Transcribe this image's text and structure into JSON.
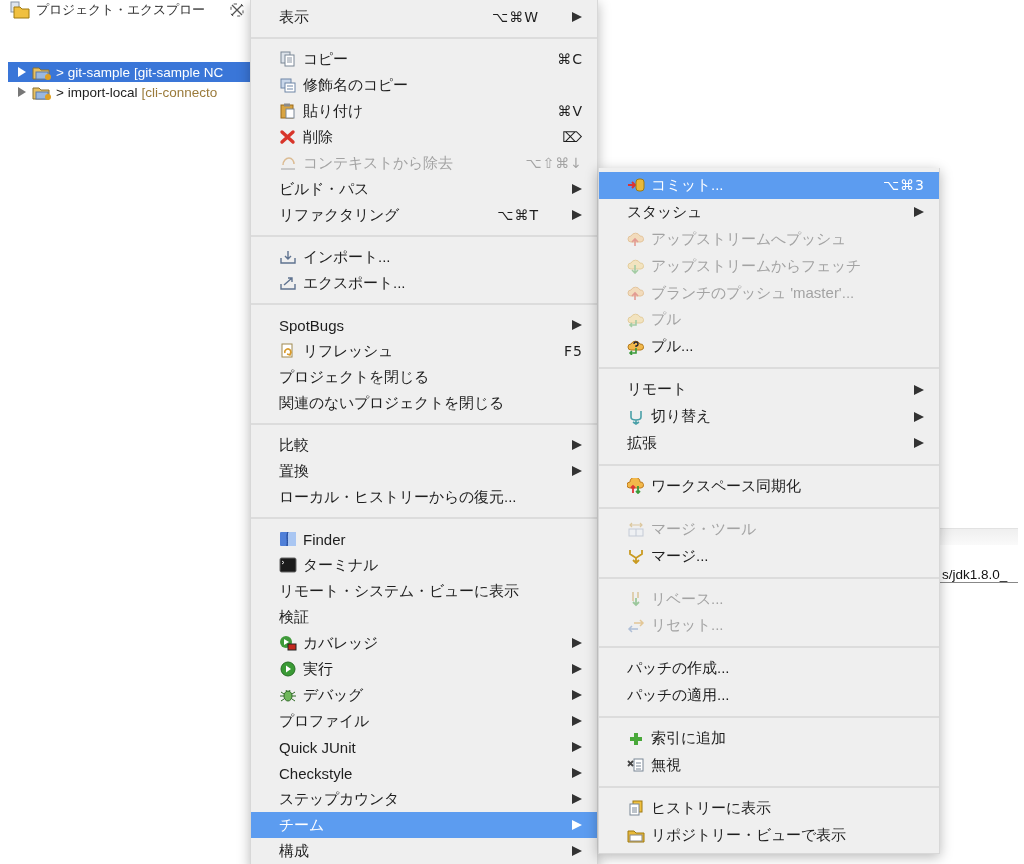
{
  "explorer": {
    "title": "プロジェクト・エクスプロー",
    "tree": [
      {
        "name": "> git-sample",
        "repo": "[git-sample NC",
        "selected": true,
        "expanded": false
      },
      {
        "name": "> import-local",
        "repo": "[cli-connecto",
        "selected": false,
        "expanded": false
      }
    ]
  },
  "context_menu": {
    "items": [
      {
        "kind": "item",
        "label": "表示",
        "shortcut": "⌥⌘W",
        "submenu": true,
        "disabled": false,
        "selected": false
      },
      {
        "kind": "separator"
      },
      {
        "kind": "item",
        "label": "コピー",
        "shortcut": "⌘C",
        "submenu": false,
        "disabled": false,
        "selected": false
      },
      {
        "kind": "item",
        "label": "修飾名のコピー",
        "submenu": false,
        "disabled": false,
        "selected": false
      },
      {
        "kind": "item",
        "label": "貼り付け",
        "shortcut": "⌘V",
        "submenu": false,
        "disabled": false,
        "selected": false
      },
      {
        "kind": "item",
        "label": "削除",
        "shortcut": "⌦",
        "submenu": false,
        "disabled": false,
        "selected": false
      },
      {
        "kind": "item",
        "label": "コンテキストから除去",
        "shortcut": "⌥⇧⌘↓",
        "submenu": false,
        "disabled": true,
        "selected": false
      },
      {
        "kind": "item",
        "label": "ビルド・パス",
        "submenu": true,
        "disabled": false,
        "selected": false
      },
      {
        "kind": "item",
        "label": "リファクタリング",
        "shortcut": "⌥⌘T",
        "submenu": true,
        "disabled": false,
        "selected": false
      },
      {
        "kind": "separator"
      },
      {
        "kind": "item",
        "label": "インポート...",
        "submenu": false,
        "disabled": false,
        "selected": false
      },
      {
        "kind": "item",
        "label": "エクスポート...",
        "submenu": false,
        "disabled": false,
        "selected": false
      },
      {
        "kind": "separator"
      },
      {
        "kind": "item",
        "label": "SpotBugs",
        "submenu": true,
        "disabled": false,
        "selected": false
      },
      {
        "kind": "item",
        "label": "リフレッシュ",
        "shortcut": "F5",
        "submenu": false,
        "disabled": false,
        "selected": false
      },
      {
        "kind": "item",
        "label": "プロジェクトを閉じる",
        "submenu": false,
        "disabled": false,
        "selected": false
      },
      {
        "kind": "item",
        "label": "関連のないプロジェクトを閉じる",
        "submenu": false,
        "disabled": false,
        "selected": false
      },
      {
        "kind": "separator"
      },
      {
        "kind": "item",
        "label": "比較",
        "submenu": true,
        "disabled": false,
        "selected": false
      },
      {
        "kind": "item",
        "label": "置換",
        "submenu": true,
        "disabled": false,
        "selected": false
      },
      {
        "kind": "item",
        "label": "ローカル・ヒストリーからの復元...",
        "submenu": false,
        "disabled": false,
        "selected": false
      },
      {
        "kind": "separator"
      },
      {
        "kind": "item",
        "label": "Finder",
        "submenu": false,
        "disabled": false,
        "selected": false
      },
      {
        "kind": "item",
        "label": "ターミナル",
        "submenu": false,
        "disabled": false,
        "selected": false
      },
      {
        "kind": "item",
        "label": "リモート・システム・ビューに表示",
        "submenu": false,
        "disabled": false,
        "selected": false
      },
      {
        "kind": "item",
        "label": "検証",
        "submenu": false,
        "disabled": false,
        "selected": false
      },
      {
        "kind": "item",
        "label": "カバレッジ",
        "submenu": true,
        "disabled": false,
        "selected": false
      },
      {
        "kind": "item",
        "label": "実行",
        "submenu": true,
        "disabled": false,
        "selected": false
      },
      {
        "kind": "item",
        "label": "デバッグ",
        "submenu": true,
        "disabled": false,
        "selected": false
      },
      {
        "kind": "item",
        "label": "プロファイル",
        "submenu": true,
        "disabled": false,
        "selected": false
      },
      {
        "kind": "item",
        "label": "Quick JUnit",
        "submenu": true,
        "disabled": false,
        "selected": false
      },
      {
        "kind": "item",
        "label": "Checkstyle",
        "submenu": true,
        "disabled": false,
        "selected": false
      },
      {
        "kind": "item",
        "label": "ステップカウンタ",
        "submenu": true,
        "disabled": false,
        "selected": false
      },
      {
        "kind": "item",
        "label": "チーム",
        "submenu": true,
        "disabled": false,
        "selected": true
      },
      {
        "kind": "item",
        "label": "構成",
        "submenu": true,
        "disabled": false,
        "selected": false
      }
    ]
  },
  "team_submenu": {
    "items": [
      {
        "kind": "item",
        "label": "コミット...",
        "shortcut": "⌥⌘3",
        "submenu": false,
        "disabled": false,
        "selected": true
      },
      {
        "kind": "item",
        "label": "スタッシュ",
        "submenu": true,
        "disabled": false,
        "selected": false
      },
      {
        "kind": "item",
        "label": "アップストリームへプッシュ",
        "submenu": false,
        "disabled": true,
        "selected": false
      },
      {
        "kind": "item",
        "label": "アップストリームからフェッチ",
        "submenu": false,
        "disabled": true,
        "selected": false
      },
      {
        "kind": "item",
        "label": "ブランチのプッシュ 'master'...",
        "submenu": false,
        "disabled": true,
        "selected": false
      },
      {
        "kind": "item",
        "label": "プル",
        "submenu": false,
        "disabled": true,
        "selected": false
      },
      {
        "kind": "item",
        "label": "プル...",
        "submenu": false,
        "disabled": false,
        "selected": false
      },
      {
        "kind": "separator"
      },
      {
        "kind": "item",
        "label": "リモート",
        "submenu": true,
        "disabled": false,
        "selected": false
      },
      {
        "kind": "item",
        "label": "切り替え",
        "submenu": true,
        "disabled": false,
        "selected": false
      },
      {
        "kind": "item",
        "label": "拡張",
        "submenu": true,
        "disabled": false,
        "selected": false
      },
      {
        "kind": "separator"
      },
      {
        "kind": "item",
        "label": "ワークスペース同期化",
        "submenu": false,
        "disabled": false,
        "selected": false
      },
      {
        "kind": "separator"
      },
      {
        "kind": "item",
        "label": "マージ・ツール",
        "submenu": false,
        "disabled": true,
        "selected": false
      },
      {
        "kind": "item",
        "label": "マージ...",
        "submenu": false,
        "disabled": false,
        "selected": false
      },
      {
        "kind": "separator"
      },
      {
        "kind": "item",
        "label": "リベース...",
        "submenu": false,
        "disabled": true,
        "selected": false
      },
      {
        "kind": "item",
        "label": "リセット...",
        "submenu": false,
        "disabled": true,
        "selected": false
      },
      {
        "kind": "separator"
      },
      {
        "kind": "item",
        "label": "パッチの作成...",
        "submenu": false,
        "disabled": false,
        "selected": false
      },
      {
        "kind": "item",
        "label": "パッチの適用...",
        "submenu": false,
        "disabled": false,
        "selected": false
      },
      {
        "kind": "separator"
      },
      {
        "kind": "item",
        "label": "索引に追加",
        "submenu": false,
        "disabled": false,
        "selected": false
      },
      {
        "kind": "item",
        "label": "無視",
        "submenu": false,
        "disabled": false,
        "selected": false
      },
      {
        "kind": "separator"
      },
      {
        "kind": "item",
        "label": "ヒストリーに表示",
        "submenu": false,
        "disabled": false,
        "selected": false
      },
      {
        "kind": "item",
        "label": "リポジトリー・ビューで表示",
        "submenu": false,
        "disabled": false,
        "selected": false
      }
    ]
  },
  "background_window": {
    "text": "s/jdk1.8.0_"
  }
}
